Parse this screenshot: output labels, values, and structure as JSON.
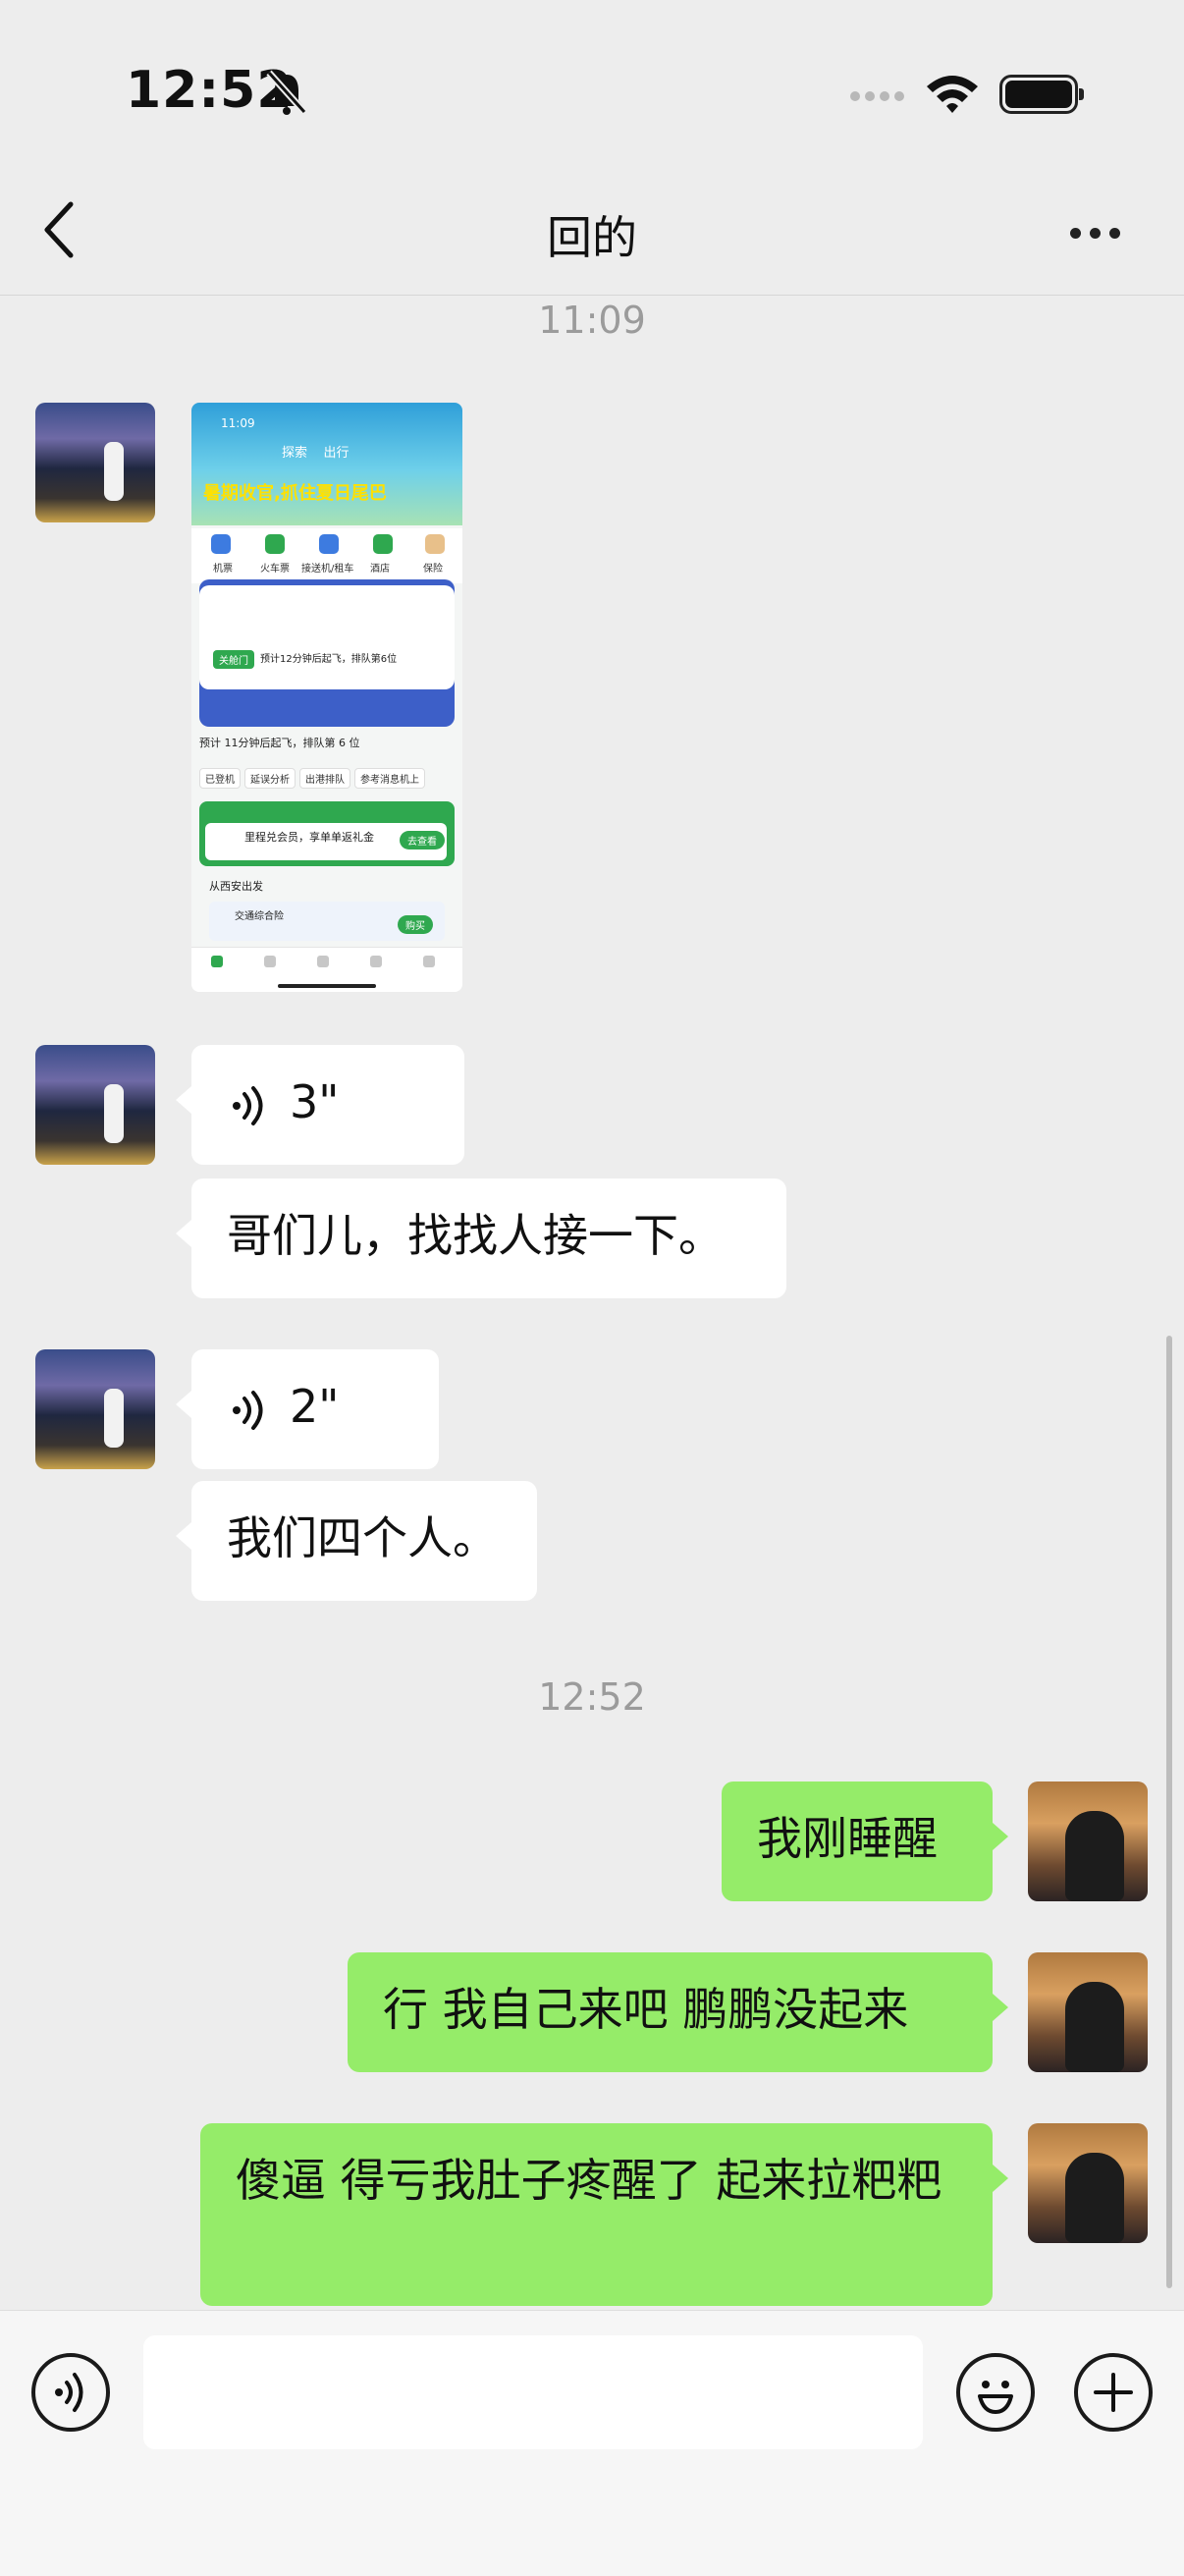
{
  "status_bar": {
    "time": "12:52"
  },
  "nav": {
    "title": "回的"
  },
  "messages": {
    "ts1": "11:09",
    "voice1": "3\"",
    "text1": "哥们儿，找找人接一下。",
    "voice2": "2\"",
    "text2": "我们四个人。",
    "ts2": "12:52",
    "me1": "我刚睡醒",
    "me2": "行 我自己来吧 鹏鹏没起来",
    "me3": "傻逼 得亏我肚子疼醒了 起来拉粑粑"
  },
  "shared_screenshot": {
    "time": "11:09",
    "tabs": "探索    出行",
    "promo": "暑期收官,抓住夏日尾巴",
    "grid": [
      "机票",
      "火车票",
      "接送机/租车",
      "酒店",
      "保险"
    ],
    "status_chip": "关舱门",
    "status_text": "预计12分钟后起飞，排队第6位",
    "row": "预计 11分钟后起飞，排队第 6 位",
    "chips": [
      "已登机",
      "延误分析",
      "出港排队",
      "参考消息机上"
    ],
    "member_text": "里程兑会员，享单单返礼金",
    "member_btn": "去查看",
    "from": "从西安出发",
    "insurance": "交通综合险",
    "insurance_btn": "购买"
  },
  "colors": {
    "my_bubble": "#95ec69",
    "friend_bubble": "#ffffff",
    "background": "#ededed"
  },
  "icons": [
    "bell-slash-icon",
    "wifi-icon",
    "battery-icon",
    "back-chevron-icon",
    "more-icon",
    "voice-wave-icon",
    "voice-input-icon",
    "emoji-icon",
    "plus-icon"
  ]
}
